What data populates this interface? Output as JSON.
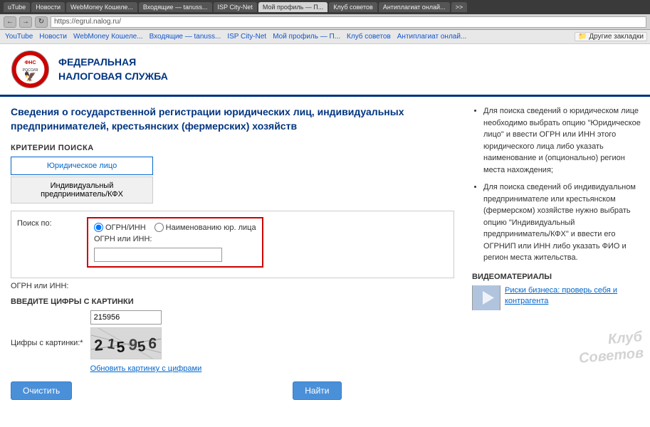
{
  "browser": {
    "tabs": [
      {
        "label": "uTube",
        "active": false
      },
      {
        "label": "Новости",
        "active": false
      },
      {
        "label": "WebMoney Кошеле...",
        "active": false
      },
      {
        "label": "Входящие — tanuss...",
        "active": false
      },
      {
        "label": "ISP City-Net",
        "active": false
      },
      {
        "label": "Мой профиль — П...",
        "active": false
      },
      {
        "label": "Клуб советов",
        "active": false
      },
      {
        "label": "Антиплагиат онлай...",
        "active": false
      },
      {
        "label": ">>",
        "active": false
      }
    ],
    "bookmarks": [
      "YouTube",
      "Новости",
      "WebMoney Кошелёк",
      "Входящие — tanuss...",
      "ISP City-Net",
      "Мой профиль — П...",
      "Клуб советов",
      "Антиплагиат онлай..."
    ],
    "other_bookmarks": "Другие закладки"
  },
  "header": {
    "title_line1": "ФЕДЕРАЛЬНАЯ",
    "title_line2": "НАЛОГОВАЯ СЛУЖБА"
  },
  "page": {
    "title": "Сведения о государственной регистрации юридических лиц, индивидуальных предпринимателей, крестьянских (фермерских) хозяйств"
  },
  "criteria_section": {
    "label": "КРИТЕРИИ ПОИСКА",
    "tab_legal": "Юридическое лицо",
    "tab_individual": "Индивидуальный предприниматель/КФХ"
  },
  "search_form": {
    "search_by_label": "Поиск по:",
    "radio_ogrn": "ОГРН/ИНН",
    "radio_name": "Наименованию юр. лица",
    "ogrn_label": "ОГРН или ИНН:",
    "ogrn_value": ""
  },
  "captcha_section": {
    "label": "ВВЕДИТЕ ЦИФРЫ С КАРТИНКИ",
    "field_label": "Цифры с картинки:*",
    "field_value": "215956",
    "captcha_display": "215956",
    "refresh_link": "Обновить картинку с цифрами"
  },
  "buttons": {
    "clear": "Очистить",
    "find": "Найти"
  },
  "right_info": {
    "bullets": [
      "Для поиска сведений о юридическом лице необходимо выбрать опцию \"Юридическое лицо\" и ввести ОГРН или ИНН этого юридического лица либо указать наименование и (опционально) регион места нахождения;",
      "Для поиска сведений об индивидуальном предпринимателе или крестьянском (фермерском) хозяйстве нужно выбрать опцию \"Индивидуальный предприниматель/КФХ\" и ввести его ОГРНИП или ИНН либо указать ФИО и регион места жительства."
    ]
  },
  "video_section": {
    "title": "ВИДЕОМАТЕРИАЛЫ",
    "link": "Риски бизнеса: проверь себя и контрагента"
  },
  "watermark": {
    "line1": "Клуб",
    "line2": "Советов"
  }
}
